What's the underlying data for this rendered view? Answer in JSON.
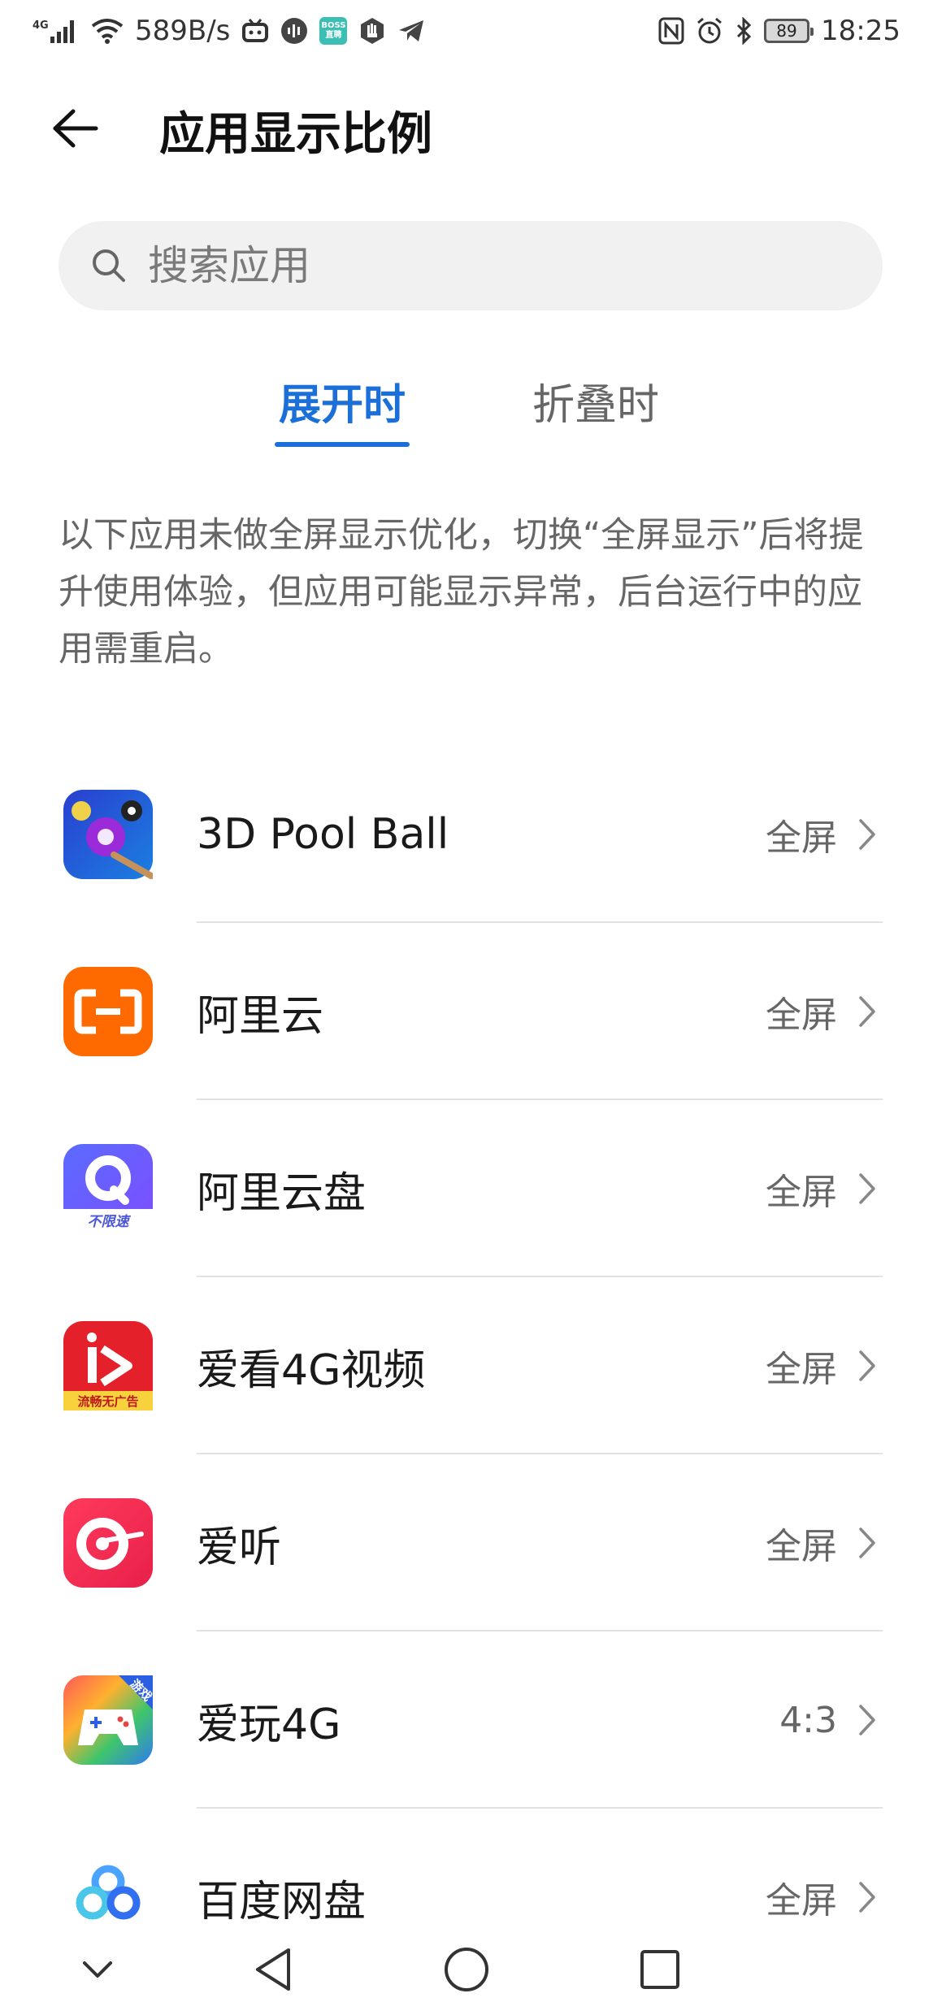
{
  "status_bar": {
    "network": "4G",
    "speed": "589B/s",
    "boss_badge": "BOSS直聘",
    "battery": "89",
    "time": "18:25"
  },
  "header": {
    "title": "应用显示比例",
    "back_icon": "arrow-left-icon"
  },
  "search": {
    "placeholder": "搜索应用",
    "value": ""
  },
  "tabs": [
    {
      "label": "展开时",
      "active": true
    },
    {
      "label": "折叠时",
      "active": false
    }
  ],
  "description": "以下应用未做全屏显示优化，切换“全屏显示”后将提升使用体验，但应用可能显示异常，后台运行中的应用需重启。",
  "apps": [
    {
      "name": "3D Pool Ball",
      "ratio": "全屏"
    },
    {
      "name": "阿里云",
      "ratio": "全屏"
    },
    {
      "name": "阿里云盘",
      "ratio": "全屏",
      "icon_caption": "不限速"
    },
    {
      "name": "爱看4G视频",
      "ratio": "全屏",
      "icon_caption": "流畅无广告"
    },
    {
      "name": "爱听",
      "ratio": "全屏"
    },
    {
      "name": "爱玩4G",
      "ratio": "4:3",
      "icon_caption": "游戏"
    },
    {
      "name": "百度网盘",
      "ratio": "全屏"
    }
  ],
  "nav_bar": [
    "collapse-chevron-icon",
    "back-triangle-icon",
    "home-circle-icon",
    "recents-square-icon"
  ],
  "colors": {
    "accent": "#1b6fd8",
    "secondary_text": "#666666",
    "search_bg": "#f1f1f1"
  }
}
